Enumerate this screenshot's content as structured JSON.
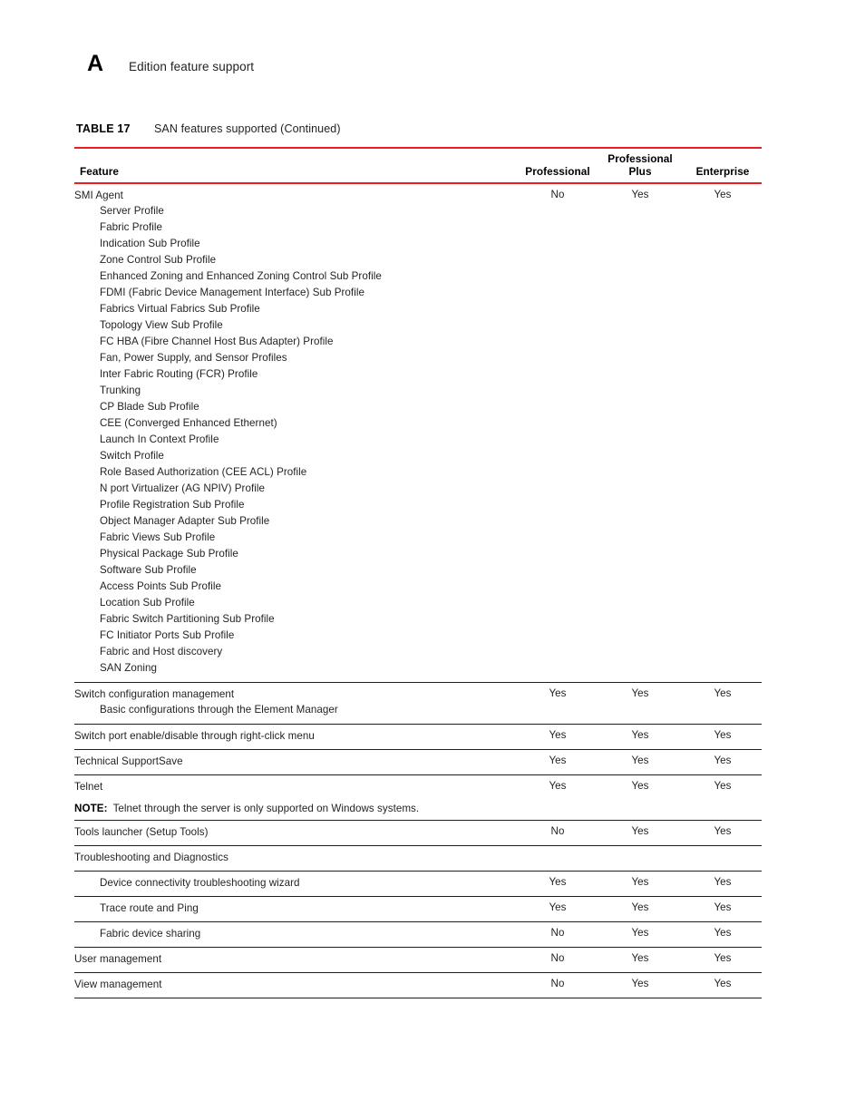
{
  "header": {
    "chapter_letter": "A",
    "chapter_title": "Edition feature support"
  },
  "caption": {
    "label": "TABLE 17",
    "text": "SAN features supported (Continued)"
  },
  "colors": {
    "rule_red": "#ED1C24",
    "rule_black": "#231F20",
    "text": "#231F20"
  },
  "table": {
    "columns": [
      "Feature",
      "Professional",
      "Professional Plus",
      "Enterprise"
    ],
    "rows": [
      {
        "feature": "SMI Agent",
        "professional": "No",
        "professional_plus": "Yes",
        "enterprise": "Yes",
        "sub_items": [
          "Server Profile",
          "Fabric Profile",
          "Indication Sub Profile",
          "Zone Control Sub Profile",
          "Enhanced Zoning and Enhanced Zoning Control Sub Profile",
          "FDMI (Fabric Device Management Interface) Sub Profile",
          "Fabrics Virtual Fabrics Sub Profile",
          "Topology View Sub Profile",
          "FC HBA (Fibre Channel Host Bus Adapter) Profile",
          "Fan, Power Supply, and Sensor Profiles",
          "Inter Fabric Routing (FCR) Profile",
          "Trunking",
          "CP Blade Sub Profile",
          "CEE (Converged Enhanced Ethernet)",
          "Launch In Context Profile",
          "Switch Profile",
          "Role Based Authorization (CEE ACL) Profile",
          "N port Virtualizer (AG NPIV) Profile",
          "Profile Registration Sub Profile",
          "Object Manager Adapter Sub Profile",
          "Fabric Views Sub Profile",
          "Physical Package Sub Profile",
          "Software Sub Profile",
          "Access Points Sub Profile",
          "Location Sub Profile",
          "Fabric Switch Partitioning Sub Profile",
          "FC Initiator Ports Sub Profile",
          "Fabric and Host discovery",
          "SAN Zoning"
        ]
      },
      {
        "feature": "Switch configuration management",
        "professional": "Yes",
        "professional_plus": "Yes",
        "enterprise": "Yes",
        "sub_items": [
          "Basic configurations through the Element Manager"
        ]
      },
      {
        "feature": "Switch port enable/disable through right-click menu",
        "professional": "Yes",
        "professional_plus": "Yes",
        "enterprise": "Yes"
      },
      {
        "feature": "Technical SupportSave",
        "professional": "Yes",
        "professional_plus": "Yes",
        "enterprise": "Yes"
      },
      {
        "feature": "Telnet",
        "professional": "Yes",
        "professional_plus": "Yes",
        "enterprise": "Yes",
        "note_label": "NOTE:",
        "note_text": "Telnet through the server is only supported on Windows systems."
      },
      {
        "feature": "Tools launcher (Setup Tools)",
        "professional": "No",
        "professional_plus": "Yes",
        "enterprise": "Yes"
      },
      {
        "feature": "Troubleshooting and Diagnostics",
        "professional": "",
        "professional_plus": "",
        "enterprise": ""
      },
      {
        "feature": "Device connectivity troubleshooting wizard",
        "indent": 1,
        "professional": "Yes",
        "professional_plus": "Yes",
        "enterprise": "Yes"
      },
      {
        "feature": "Trace route and Ping",
        "indent": 1,
        "professional": "Yes",
        "professional_plus": "Yes",
        "enterprise": "Yes"
      },
      {
        "feature": "Fabric device sharing",
        "indent": 1,
        "professional": "No",
        "professional_plus": "Yes",
        "enterprise": "Yes"
      },
      {
        "feature": "User management",
        "professional": "No",
        "professional_plus": "Yes",
        "enterprise": "Yes"
      },
      {
        "feature": "View management",
        "professional": "No",
        "professional_plus": "Yes",
        "enterprise": "Yes"
      }
    ]
  }
}
